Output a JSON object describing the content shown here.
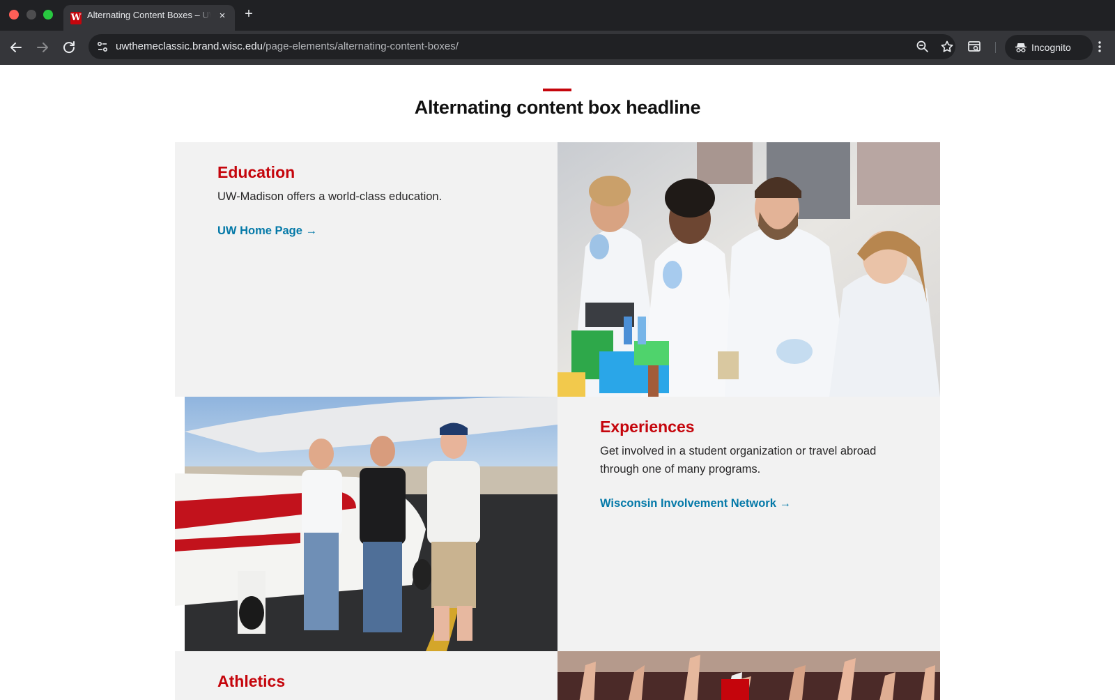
{
  "browser": {
    "tab_title": "Alternating Content Boxes – UW Theme Classic",
    "tab_close": "×",
    "new_tab": "+",
    "url_host": "uwthemeclassic.brand.wisc.edu",
    "url_path": "/page-elements/alternating-content-boxes/",
    "incognito_label": "Incognito",
    "favicon_letter": "W",
    "icons": {
      "back": "back-arrow-icon",
      "forward": "forward-arrow-icon",
      "reload": "reload-icon",
      "site_info": "site-settings-icon",
      "zoom": "zoom-icon",
      "bookmark": "star-icon",
      "cast": "cast-search-icon",
      "incognito": "incognito-icon",
      "menu": "kebab-menu-icon"
    }
  },
  "page": {
    "headline": "Alternating content box headline",
    "accent_color": "#c5050c",
    "link_color": "#0479a8",
    "boxes": [
      {
        "title": "Education",
        "body": "UW-Madison offers a world-class education.",
        "link": "UW Home Page →"
      },
      {
        "title": "Experiences",
        "body": "Get involved in a student organization or travel abroad through one of many programs.",
        "link": "Wisconsin Involvement Network →"
      },
      {
        "title": "Athletics"
      }
    ]
  }
}
